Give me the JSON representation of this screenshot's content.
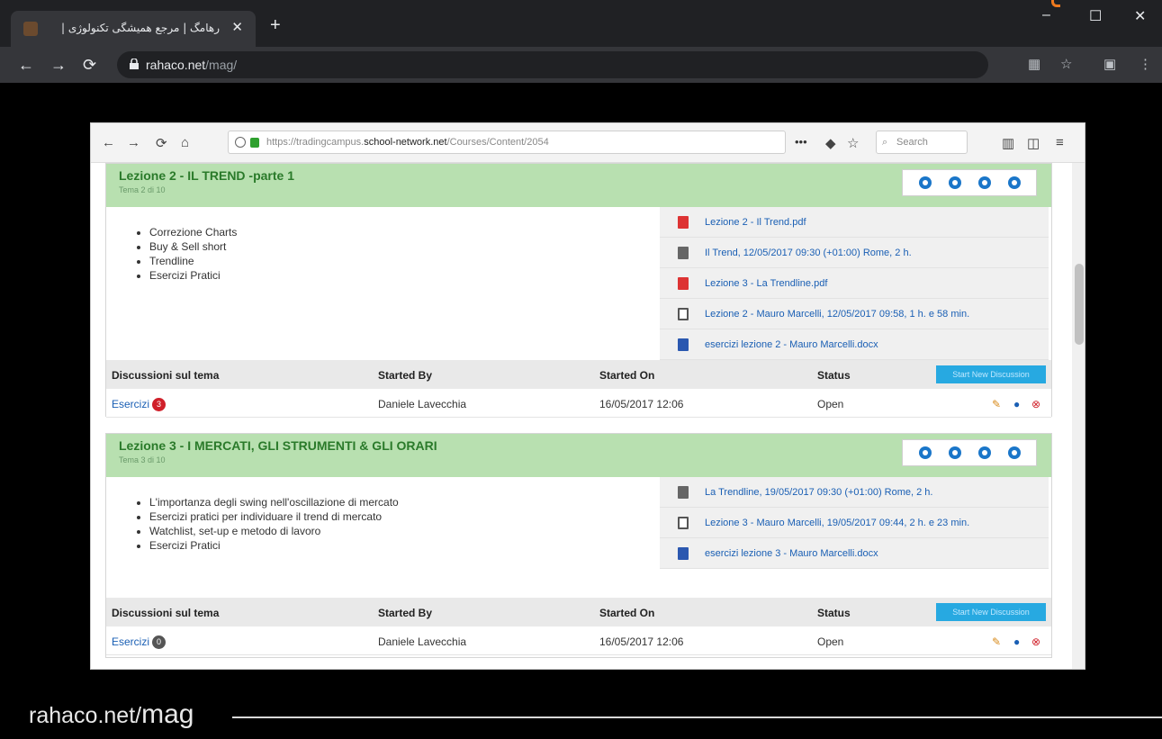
{
  "browser": {
    "tab_title": "رهامگ | مرجع همیشگی تکنولوژی |",
    "tab_close": "✕",
    "new_tab": "+",
    "url_host": "rahaco.net",
    "url_path": "/mag/",
    "window_controls": [
      "–",
      "☐",
      "✕"
    ]
  },
  "inner_browser": {
    "url_prefix": "https://tradingcampus.",
    "url_host": "school-network.net",
    "url_path": "/Courses/Content/2054",
    "more": "•••",
    "search_placeholder": "Search"
  },
  "lessons": [
    {
      "title": "Lezione 2 - IL TREND -parte 1",
      "subtitle": "Tema 2 di 10",
      "topics": [
        "Correzione Charts",
        "Buy & Sell short",
        "Trendline",
        "Esercizi Pratici"
      ],
      "files": [
        {
          "icon": "pdf-icon",
          "label": "Lezione 2 - Il Trend.pdf"
        },
        {
          "icon": "calendar-icon",
          "label": "Il Trend, 12/05/2017 09:30 (+01:00) Rome, 2 h."
        },
        {
          "icon": "pdf-icon",
          "label": "Lezione 3 - La Trendline.pdf"
        },
        {
          "icon": "video-icon",
          "label": "Lezione 2 - Mauro Marcelli, 12/05/2017 09:58, 1 h. e 58 min."
        },
        {
          "icon": "word-doc-icon",
          "label": "esercizi lezione 2 - Mauro Marcelli.docx"
        }
      ],
      "discussion": {
        "headers": [
          "Discussioni sul tema",
          "Started By",
          "Started On",
          "Status"
        ],
        "start_button": "Start New Discussion",
        "row": {
          "topic": "Esercizi",
          "count": "3",
          "started_by": "Daniele Lavecchia",
          "started_on": "16/05/2017 12:06",
          "status": "Open"
        }
      }
    },
    {
      "title": "Lezione 3 - I MERCATI, GLI STRUMENTI & GLI ORARI",
      "subtitle": "Tema 3 di 10",
      "topics": [
        "L'importanza degli swing nell'oscillazione di mercato",
        "Esercizi pratici per individuare il trend di mercato",
        "Watchlist, set-up e metodo di lavoro",
        "Esercizi Pratici"
      ],
      "files": [
        {
          "icon": "calendar-icon",
          "label": "La Trendline, 19/05/2017 09:30 (+01:00) Rome, 2 h."
        },
        {
          "icon": "video-icon",
          "label": "Lezione 3 - Mauro Marcelli, 19/05/2017 09:44, 2 h. e 23 min."
        },
        {
          "icon": "word-doc-icon",
          "label": "esercizi lezione 3 - Mauro Marcelli.docx"
        }
      ],
      "discussion": {
        "headers": [
          "Discussioni sul tema",
          "Started By",
          "Started On",
          "Status"
        ],
        "start_button": "Start New Discussion",
        "row": {
          "topic": "Esercizi",
          "count": "0",
          "started_by": "Daniele Lavecchia",
          "started_on": "16/05/2017 12:06",
          "status": "Open"
        }
      }
    }
  ],
  "footer": {
    "text_prefix": "rahaco.net/",
    "text_main": "mag"
  },
  "colors": {
    "header_green": "#b8e0b0",
    "title_green": "#2a7a2a",
    "link_blue": "#1a5fb4",
    "accent_orange": "#f07a1e",
    "badge_red": "#d0202a",
    "badge_gray": "#555555"
  }
}
